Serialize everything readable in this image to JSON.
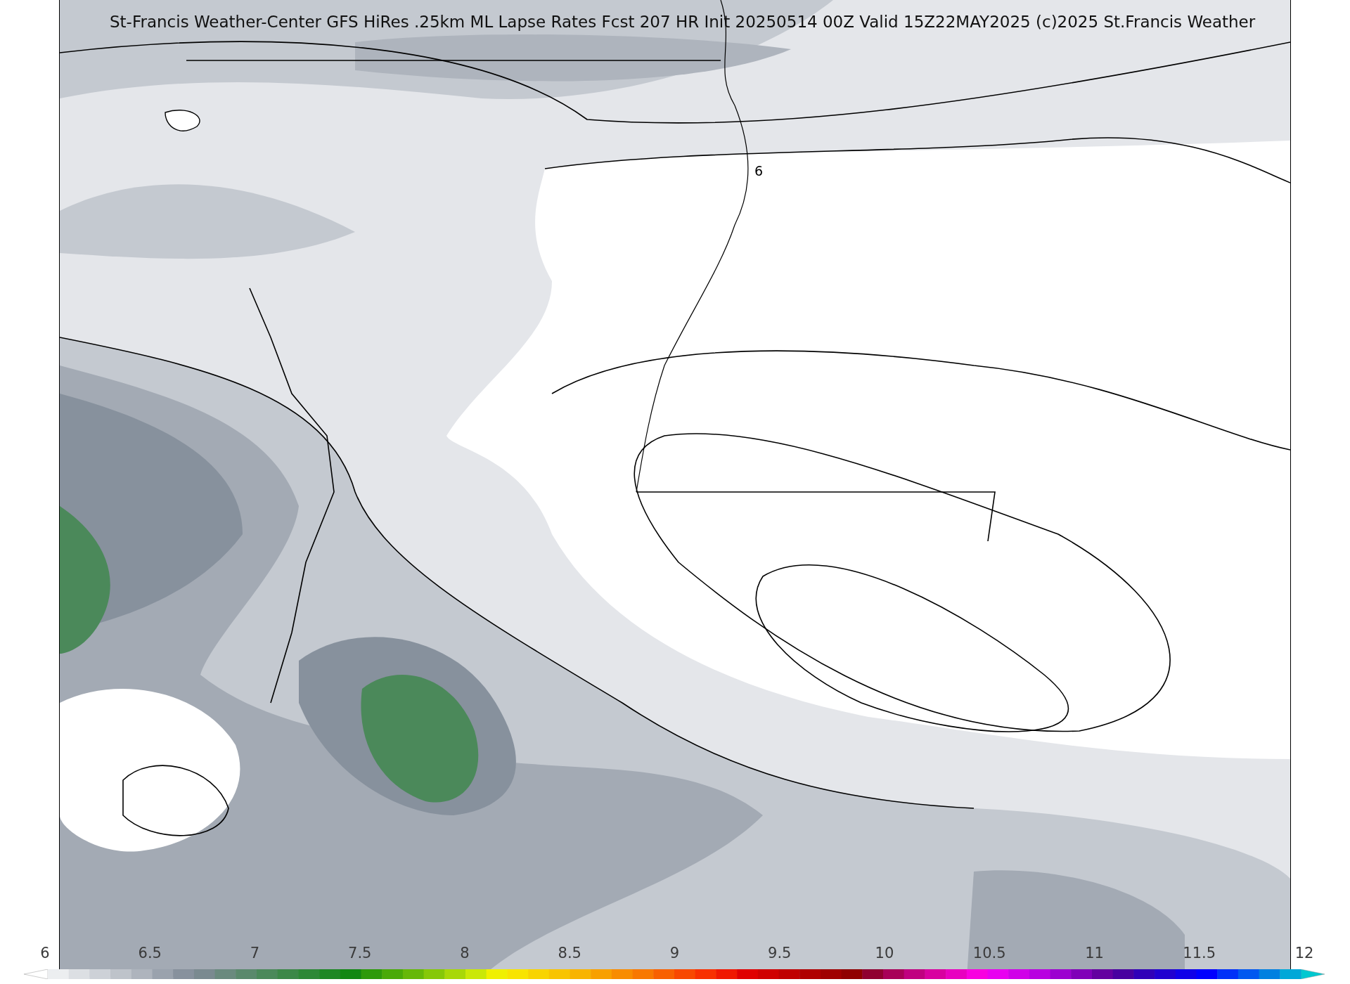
{
  "title": "St-Francis Weather-Center GFS HiRes .25km ML Lapse Rates  Fcst 207 HR Init 20250514 00Z  Valid 15Z22MAY2025    (c)2025 St.Francis Weather",
  "contour_label": "6",
  "colorbar": {
    "ticks": [
      "6",
      "6.5",
      "7",
      "7.5",
      "8",
      "8.5",
      "9",
      "9.5",
      "10",
      "10.5",
      "11",
      "11.5",
      "12"
    ],
    "ends": [
      {
        "kind": "under",
        "color": "#ffffff"
      },
      {
        "kind": "over",
        "color": "#00c8d0"
      }
    ],
    "bins": [
      {
        "color": "#eceef0"
      },
      {
        "color": "#dcdfe3"
      },
      {
        "color": "#cdd1d7"
      },
      {
        "color": "#bec3ca"
      },
      {
        "color": "#aeb4bd"
      },
      {
        "color": "#9aa2ad"
      },
      {
        "color": "#87919d"
      },
      {
        "color": "#7a8a90"
      },
      {
        "color": "#6a8a7e"
      },
      {
        "color": "#5a896c"
      },
      {
        "color": "#4b895a"
      },
      {
        "color": "#3c8848"
      },
      {
        "color": "#2d8836"
      },
      {
        "color": "#1e8724"
      },
      {
        "color": "#128712"
      },
      {
        "color": "#2e9a0a"
      },
      {
        "color": "#4aaa08"
      },
      {
        "color": "#66b808"
      },
      {
        "color": "#86c808"
      },
      {
        "color": "#a8d808"
      },
      {
        "color": "#cae808"
      },
      {
        "color": "#f0f000"
      },
      {
        "color": "#f8e400"
      },
      {
        "color": "#f8d400"
      },
      {
        "color": "#f8c400"
      },
      {
        "color": "#f8b400"
      },
      {
        "color": "#f8a000"
      },
      {
        "color": "#f88c00"
      },
      {
        "color": "#f87800"
      },
      {
        "color": "#f86000"
      },
      {
        "color": "#f84800"
      },
      {
        "color": "#f83000"
      },
      {
        "color": "#f01800"
      },
      {
        "color": "#e00000"
      },
      {
        "color": "#d00000"
      },
      {
        "color": "#c00000"
      },
      {
        "color": "#b00000"
      },
      {
        "color": "#a00000"
      },
      {
        "color": "#900000"
      },
      {
        "color": "#900030"
      },
      {
        "color": "#a80058"
      },
      {
        "color": "#c00080"
      },
      {
        "color": "#d800a0"
      },
      {
        "color": "#e800c0"
      },
      {
        "color": "#f800e0"
      },
      {
        "color": "#e800f0"
      },
      {
        "color": "#d000e8"
      },
      {
        "color": "#b800e0"
      },
      {
        "color": "#9c00d0"
      },
      {
        "color": "#8000b8"
      },
      {
        "color": "#6400a0"
      },
      {
        "color": "#4800a0"
      },
      {
        "color": "#3000b8"
      },
      {
        "color": "#2000d0"
      },
      {
        "color": "#1000e8"
      },
      {
        "color": "#0000ff"
      },
      {
        "color": "#0030f8"
      },
      {
        "color": "#0058f0"
      },
      {
        "color": "#0080e0"
      },
      {
        "color": "#00a8d8"
      }
    ]
  }
}
